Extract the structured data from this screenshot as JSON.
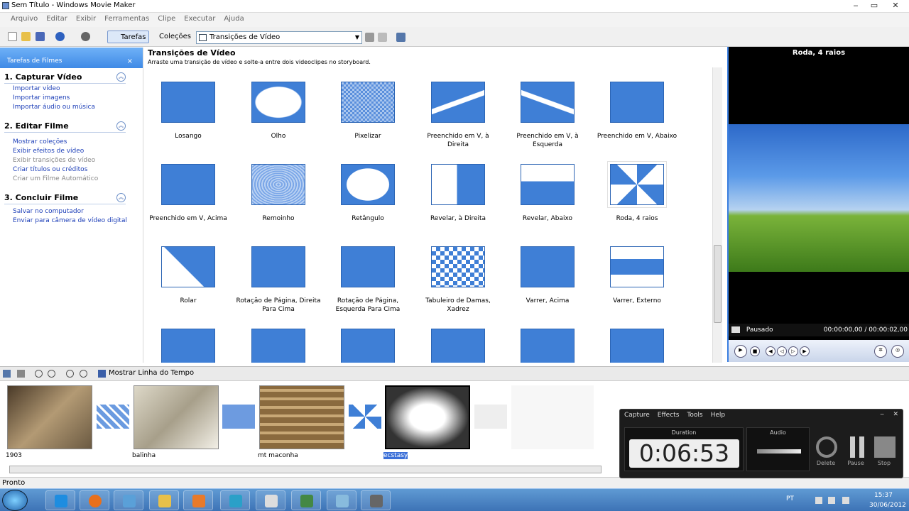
{
  "window": {
    "title": "Sem Título - Windows Movie Maker",
    "min": "‒",
    "max": "▭",
    "close": "✕"
  },
  "menu": [
    "Arquivo",
    "Editar",
    "Exibir",
    "Ferramentas",
    "Clipe",
    "Executar",
    "Ajuda"
  ],
  "toolbar": {
    "tarefas": "Tarefas",
    "colecoes": "Coleções",
    "dropdown": "Transições de Vídeo",
    "arrow": "▼"
  },
  "tasks": {
    "header": "Tarefas de Filmes",
    "close": "×",
    "collapse": "︽",
    "sections": [
      {
        "title": "1. Capturar Vídeo",
        "links": [
          "Importar vídeo",
          "Importar imagens",
          "Importar áudio ou música"
        ]
      },
      {
        "title": "2. Editar Filme",
        "links": [
          "Mostrar coleções",
          "Exibir efeitos de vídeo",
          "Exibir transições de vídeo",
          "Criar títulos ou créditos",
          "Criar um Filme Automático"
        ]
      },
      {
        "title": "3. Concluir Filme",
        "links": [
          "Salvar no computador",
          "Enviar para câmera de vídeo digital"
        ]
      }
    ]
  },
  "center": {
    "title": "Transições de Vídeo",
    "subtitle": "Arraste uma transição de vídeo e solte-a entre dois videoclipes no storyboard."
  },
  "transitions": [
    "Losango",
    "Olho",
    "Pixelizar",
    "Preenchido em V, à Direita",
    "Preenchido em V, à Esquerda",
    "Preenchido em V, Abaixo",
    "Preenchido em V, Acima",
    "Remoinho",
    "Retângulo",
    "Revelar, à Direita",
    "Revelar, Abaixo",
    "Roda, 4 raios",
    "Rolar",
    "Rotação de Página, Direita Para Cima",
    "Rotação de Página, Esquerda Para Cima",
    "Tabuleiro de Damas, Xadrez",
    "Varrer, Acima",
    "Varrer, Externo"
  ],
  "preview": {
    "title": "Roda, 4 raios",
    "status": "Pausado",
    "time": "00:00:00,00 / 00:00:02,00"
  },
  "storyboard": {
    "show_timeline": "Mostrar Linha do Tempo",
    "clips": [
      "1903",
      "balinha",
      "mt maconha",
      "ecstasy"
    ]
  },
  "status": "Pronto",
  "recorder": {
    "menu": [
      "Capture",
      "Effects",
      "Tools",
      "Help"
    ],
    "duration_label": "Duration",
    "duration": "0:06:53",
    "audio_label": "Audio",
    "buttons": [
      "Delete",
      "Pause",
      "Stop"
    ],
    "min": "‒",
    "close": "✕"
  },
  "tray": {
    "lang": "PT",
    "time": "15:37",
    "date": "30/06/2012"
  }
}
